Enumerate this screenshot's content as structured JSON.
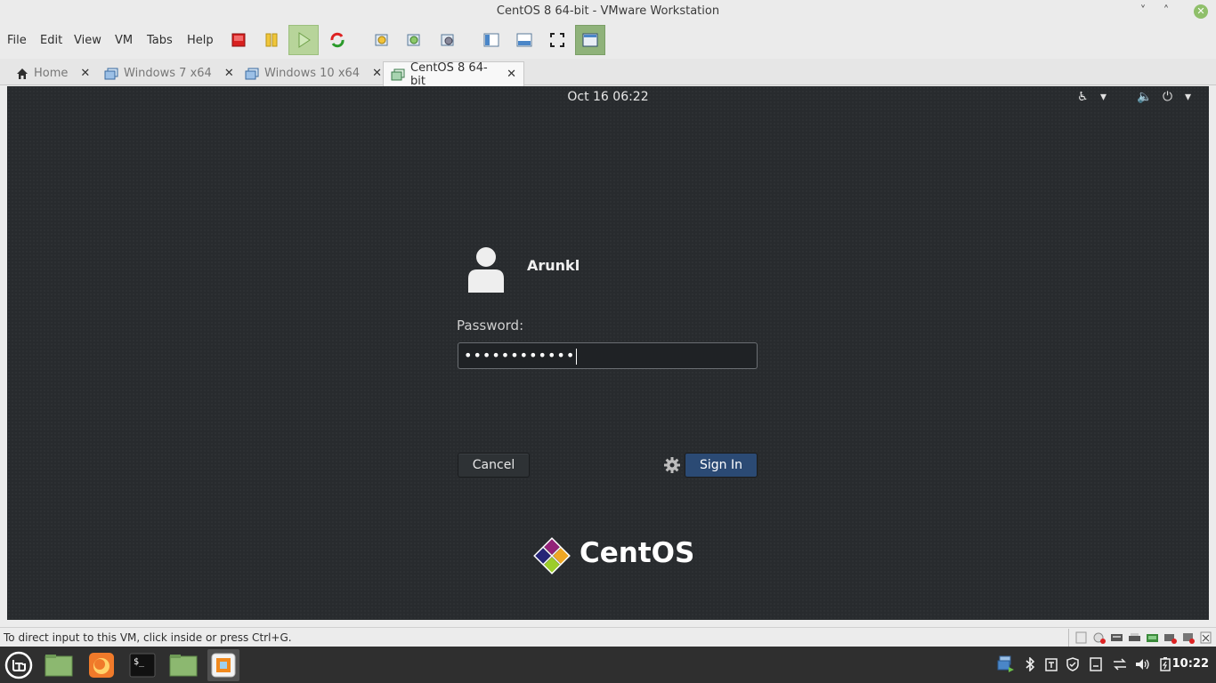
{
  "window": {
    "title": "CentOS 8 64-bit - VMware Workstation",
    "controls": {
      "minimize": "˅",
      "maximize": "˄",
      "close": "✕"
    }
  },
  "menu": [
    "File",
    "Edit",
    "View",
    "VM",
    "Tabs",
    "Help"
  ],
  "toolbar": {
    "icons": [
      "power-off-icon",
      "suspend-icon",
      "power-on-icon",
      "reset-icon",
      "snapshot-icon",
      "revert-snapshot-icon",
      "snapshot-manager-icon",
      "library-icon",
      "thumbnail-bar-icon",
      "fullscreen-icon",
      "unity-icon"
    ]
  },
  "tabs": [
    {
      "label": "Home",
      "icon": "home-icon",
      "active": false
    },
    {
      "label": "Windows 7 x64",
      "icon": "vm-icon",
      "active": false
    },
    {
      "label": "Windows 10 x64",
      "icon": "vm-icon",
      "active": false
    },
    {
      "label": "CentOS 8 64-bit",
      "icon": "vm-icon",
      "active": true
    }
  ],
  "tab_close": "✕",
  "vm": {
    "clock": "Oct 16  06:22",
    "username": "Arunkl",
    "password_label": "Password:",
    "password_value": "••••••••••••",
    "cancel_label": "Cancel",
    "signin_label": "Sign In",
    "brand_text": "CentOS",
    "top_icons": {
      "accessibility": "♿",
      "dropdown": "▾",
      "volume": "🔈",
      "power": "⏻"
    }
  },
  "status": {
    "text": "To direct input to this VM, click inside or press Ctrl+G."
  },
  "taskbar": {
    "time": "10:22",
    "apps": [
      "mint-menu-icon",
      "folder-icon",
      "firefox-icon",
      "terminal-icon",
      "files-icon",
      "vmware-icon"
    ],
    "terminal_glyph": "$_"
  },
  "colors": {
    "vm_background": "#282b2e",
    "signin_button": "#2b4a74",
    "taskbar": "#2f2f2f",
    "toolbar_active": "#b7d49a"
  }
}
